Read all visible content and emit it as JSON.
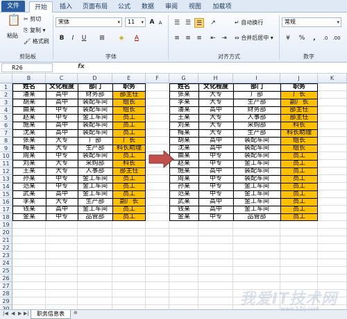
{
  "ribbon_tabs": [
    "文件",
    "开始",
    "插入",
    "页面布局",
    "公式",
    "数据",
    "审阅",
    "视图",
    "加载项"
  ],
  "clipboard": {
    "paste": "粘贴",
    "cut": "剪切",
    "copy": "复制 ▾",
    "format_painter": "格式刷",
    "label": "剪贴板"
  },
  "font": {
    "name": "宋体",
    "size": "11",
    "grow": "A",
    "shrink": "A",
    "bold": "B",
    "italic": "I",
    "underline": "U",
    "font_color": "A",
    "label": "字体"
  },
  "alignment": {
    "wrap": "自动换行",
    "merge": "合并后居中 ▾",
    "label": "对齐方式"
  },
  "number": {
    "format": "常规",
    "percent": "%",
    "comma": ",",
    "label": "数字"
  },
  "namebox": "R26",
  "fx": "fx",
  "columns": [
    "B",
    "C",
    "D",
    "E",
    "F",
    "G",
    "H",
    "I",
    "J",
    "K"
  ],
  "rows": [
    "1",
    "2",
    "3",
    "4",
    "5",
    "6",
    "7",
    "8",
    "9",
    "10",
    "11",
    "12",
    "13",
    "14",
    "15",
    "16",
    "17",
    "18",
    "19",
    "20",
    "21",
    "22",
    "23",
    "24",
    "25",
    "26",
    "27",
    "28",
    "29",
    "30"
  ],
  "headers": [
    "姓名",
    "文化程度",
    "部门",
    "职务"
  ],
  "left_table": [
    [
      "潘某",
      "高中",
      "财务部",
      "部主任"
    ],
    [
      "胡某",
      "高中",
      "装配车间",
      "组长"
    ],
    [
      "曲某",
      "中专",
      "装配车间",
      "组长"
    ],
    [
      "赵某",
      "中专",
      "金工车间",
      "员工"
    ],
    [
      "施某",
      "高中",
      "装配车间",
      "员工"
    ],
    [
      "沈某",
      "高中",
      "装配车间",
      "员工"
    ],
    [
      "张某",
      "大专",
      "厂部",
      "厂长"
    ],
    [
      "梅某",
      "大专",
      "生产部",
      "科长助理"
    ],
    [
      "周某",
      "中专",
      "装配车间",
      "员工"
    ],
    [
      "刘某",
      "大专",
      "采购部",
      "科长"
    ],
    [
      "王某",
      "大专",
      "人事部",
      "部主任"
    ],
    [
      "孙某",
      "中专",
      "金工车间",
      "员工"
    ],
    [
      "范某",
      "中专",
      "金工车间",
      "员工"
    ],
    [
      "武某",
      "高中",
      "金工车间",
      "员工"
    ],
    [
      "李某",
      "大专",
      "生产部",
      "副厂长"
    ],
    [
      "钱某",
      "高中",
      "金工车间",
      "员工"
    ],
    [
      "金某",
      "中专",
      "品管部",
      "员工"
    ]
  ],
  "right_table": [
    [
      "张某",
      "大专",
      "厂部",
      "厂长"
    ],
    [
      "李某",
      "大专",
      "生产部",
      "副厂长"
    ],
    [
      "潘某",
      "高中",
      "财务部",
      "部主任"
    ],
    [
      "王某",
      "大专",
      "人事部",
      "部主任"
    ],
    [
      "刘某",
      "大专",
      "采购部",
      "科长"
    ],
    [
      "梅某",
      "大专",
      "生产部",
      "科长助理"
    ],
    [
      "胡某",
      "高中",
      "装配车间",
      "组长"
    ],
    [
      "沈某",
      "高中",
      "装配车间",
      "组长"
    ],
    [
      "曲某",
      "中专",
      "装配车间",
      "员工"
    ],
    [
      "赵某",
      "中专",
      "金工车间",
      "员工"
    ],
    [
      "施某",
      "高中",
      "装配车间",
      "员工"
    ],
    [
      "周某",
      "中专",
      "装配车间",
      "员工"
    ],
    [
      "孙某",
      "中专",
      "金工车间",
      "员工"
    ],
    [
      "范某",
      "中专",
      "金工车间",
      "员工"
    ],
    [
      "武某",
      "高中",
      "金工车间",
      "员工"
    ],
    [
      "钱某",
      "高中",
      "金工车间",
      "员工"
    ],
    [
      "金某",
      "中专",
      "品管部",
      "员工"
    ]
  ],
  "sheet_tab": "职务信息表",
  "watermark": "我爱IT技术网",
  "watermark_url": "www.52ij.com",
  "colors": {
    "highlight": "#ffc000",
    "arrow": "#c0504d",
    "file_tab": "#2a5d9f"
  }
}
